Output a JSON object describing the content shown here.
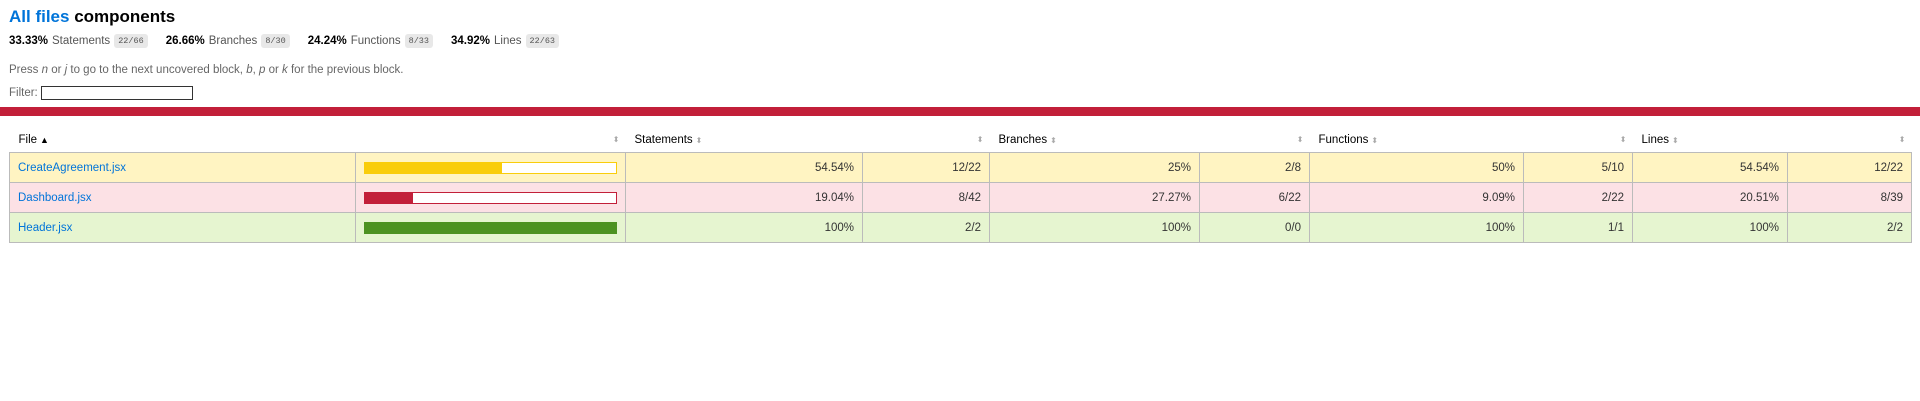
{
  "header": {
    "root_link": "All files",
    "dir": "components"
  },
  "summary": [
    {
      "pct": "33.33%",
      "label": "Statements",
      "fraction": "22/66"
    },
    {
      "pct": "26.66%",
      "label": "Branches",
      "fraction": "8/30"
    },
    {
      "pct": "24.24%",
      "label": "Functions",
      "fraction": "8/33"
    },
    {
      "pct": "34.92%",
      "label": "Lines",
      "fraction": "22/63"
    }
  ],
  "hint": {
    "p1": "Press ",
    "k1": "n",
    "p2": " or ",
    "k2": "j",
    "p3": " to go to the next uncovered block, ",
    "k3": "b",
    "p4": ", ",
    "k4": "p",
    "p5": " or ",
    "k5": "k",
    "p6": " for the previous block."
  },
  "filter": {
    "label": "Filter:",
    "value": ""
  },
  "colors": {
    "low": "#C21F39",
    "medium": "#f9cd0b",
    "high": "#4d9221",
    "link": "#0074D9"
  },
  "table": {
    "headers": {
      "file": "File",
      "statements": "Statements",
      "branches": "Branches",
      "functions": "Functions",
      "lines": "Lines"
    },
    "rows": [
      {
        "file": "CreateAgreement.jsx",
        "level": "medium",
        "coverage": 54.54,
        "statements_pct": "54.54%",
        "statements_frac": "12/22",
        "branches_pct": "25%",
        "branches_frac": "2/8",
        "functions_pct": "50%",
        "functions_frac": "5/10",
        "lines_pct": "54.54%",
        "lines_frac": "12/22"
      },
      {
        "file": "Dashboard.jsx",
        "level": "low",
        "coverage": 19.04,
        "statements_pct": "19.04%",
        "statements_frac": "8/42",
        "branches_pct": "27.27%",
        "branches_frac": "6/22",
        "functions_pct": "9.09%",
        "functions_frac": "2/22",
        "lines_pct": "20.51%",
        "lines_frac": "8/39"
      },
      {
        "file": "Header.jsx",
        "level": "high",
        "coverage": 100,
        "statements_pct": "100%",
        "statements_frac": "2/2",
        "branches_pct": "100%",
        "branches_frac": "0/0",
        "functions_pct": "100%",
        "functions_frac": "1/1",
        "lines_pct": "100%",
        "lines_frac": "2/2"
      }
    ]
  }
}
